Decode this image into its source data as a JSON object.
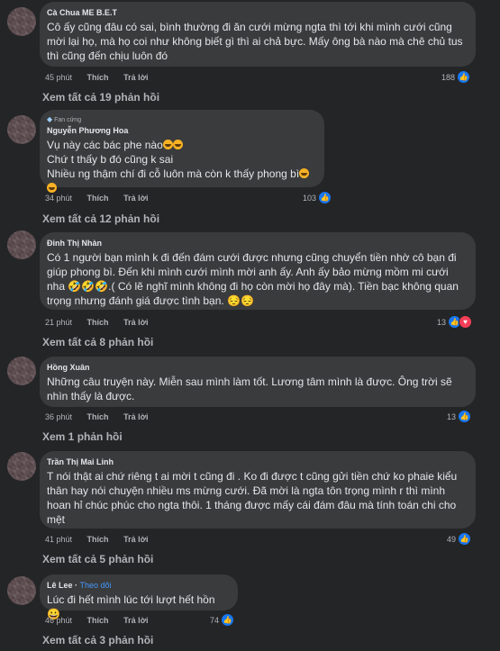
{
  "comments": [
    {
      "name": "Cà Chua ME B.E.T",
      "text": "Cô ấy cũng đâu có sai, bình thường đi ăn cưới mừng ngta thì tới khi mình cưới cũng mời lại họ, mà họ coi như không biết gì thì ai chả bực. Mấy ông bà nào mà chê chủ tus thì cũng đến chịu luôn đó",
      "time": "45 phút",
      "like": "Thích",
      "reply": "Trả lời",
      "reactions": "188",
      "view_replies": "Xem tất cả 19 phản hồi"
    },
    {
      "fan_label": "Fan cứng",
      "name": "Nguyễn Phương Hoa",
      "text_lines": [
        "Vụ này các bác phe nào",
        "Chứ t thấy b đó cũng k sai",
        "Nhiều ng thậm chí đi cỗ luôn mà còn k thấy phong bì"
      ],
      "time": "34 phút",
      "like": "Thích",
      "reply": "Trả lời",
      "reactions": "103",
      "view_replies": "Xem tất cả 12 phản hồi"
    },
    {
      "name": "Đinh Thị Nhàn",
      "text": "Có 1 người bạn mình k đi đến đám cưới được nhưng cũng chuyển tiền nhờ cô bạn đi giúp phong bì. Đến khi mình cưới mình mời anh ấy. Anh ấy bảo mừng mồm mi cưới nha 🤣🤣🤣.( Có lẽ nghĩ mình không đi họ còn mời họ đây mà). Tiền bạc không quan trọng nhưng đánh giá được tình bạn. 😔😔",
      "time": "21 phút",
      "like": "Thích",
      "reply": "Trả lời",
      "reactions": "13",
      "view_replies": "Xem tất cả 8 phản hồi"
    },
    {
      "name": "Hồng Xuân",
      "text": "Những câu truyện này. Miễn sau mình làm tốt. Lương tâm mình là được. Ông trời sẽ nhìn thấy là được.",
      "time": "36 phút",
      "like": "Thích",
      "reply": "Trả lời",
      "reactions": "13",
      "view_replies": "Xem 1 phản hồi"
    },
    {
      "name": "Trần Thị Mai Linh",
      "text": "T nói thật ai chứ riêng t ai mời t cũng đi . Ko đi được t cũng gửi tiền chứ ko phaie kiểu thân hay nói chuyện nhiều ms mừng cưới. Đã mời là ngta tôn trọng mình r thì mình hoan hỉ chúc phúc cho ngta thôi. 1 tháng được mấy cái đám đâu mà tính toán chi cho mệt",
      "time": "41 phút",
      "like": "Thích",
      "reply": "Trả lời",
      "reactions": "49",
      "view_replies": "Xem tất cả 5 phản hồi"
    },
    {
      "name": "Lê Lee",
      "follow": "Theo dõi",
      "text": "Lúc đi hết mình lúc tới lượt hết hồn 😀",
      "time": "46 phút",
      "like": "Thích",
      "reply": "Trả lời",
      "reactions": "74",
      "view_replies": "Xem tất cả 3 phản hồi"
    }
  ],
  "colors": {
    "background": "#242526",
    "bubble": "#3a3b3c",
    "like_blue": "#1877f2",
    "love_red": "#f33e58",
    "follow_blue": "#4599ff"
  }
}
